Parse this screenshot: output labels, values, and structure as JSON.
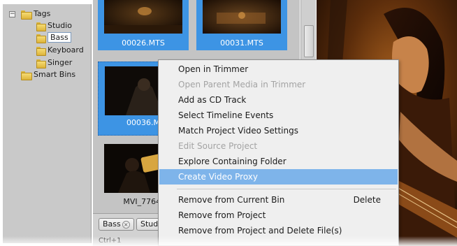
{
  "tree": {
    "root": {
      "label": "Tags",
      "expander": "−"
    },
    "children": [
      {
        "label": "Studio"
      },
      {
        "label": "Bass",
        "selected": true
      },
      {
        "label": "Keyboard"
      },
      {
        "label": "Singer"
      }
    ],
    "smart_bins": {
      "label": "Smart Bins"
    }
  },
  "bin": {
    "clips": [
      {
        "name": "00026.MTS"
      },
      {
        "name": "00031.MTS"
      },
      {
        "name": "00036.M"
      },
      {
        "name": "MVI_7764."
      }
    ]
  },
  "filter": {
    "chips": [
      {
        "label": "Bass",
        "close_glyph": "×"
      },
      {
        "label": "Stud"
      }
    ],
    "partial_text": "Ctrl+1"
  },
  "context_menu": {
    "items": [
      {
        "label": "Open in Trimmer",
        "enabled": true
      },
      {
        "label": "Open Parent Media in Trimmer",
        "enabled": false
      },
      {
        "label": "Add as CD Track",
        "enabled": true
      },
      {
        "label": "Select Timeline Events",
        "enabled": true
      },
      {
        "label": "Match Project Video Settings",
        "enabled": true
      },
      {
        "label": "Edit Source Project",
        "enabled": false
      },
      {
        "label": "Explore Containing Folder",
        "enabled": true
      },
      {
        "label": "Create Video Proxy",
        "enabled": true,
        "highlighted": true
      },
      {
        "label": "Remove from Current Bin",
        "enabled": true,
        "shortcut": "Delete"
      },
      {
        "label": "Remove from Project",
        "enabled": true
      },
      {
        "label": "Remove from Project and Delete File(s)",
        "enabled": true
      }
    ]
  },
  "colors": {
    "selection_blue": "#3d94e4",
    "menu_highlight": "#7eb4ea",
    "menu_background": "#efefef",
    "panel_gray": "#c4c4c4"
  }
}
